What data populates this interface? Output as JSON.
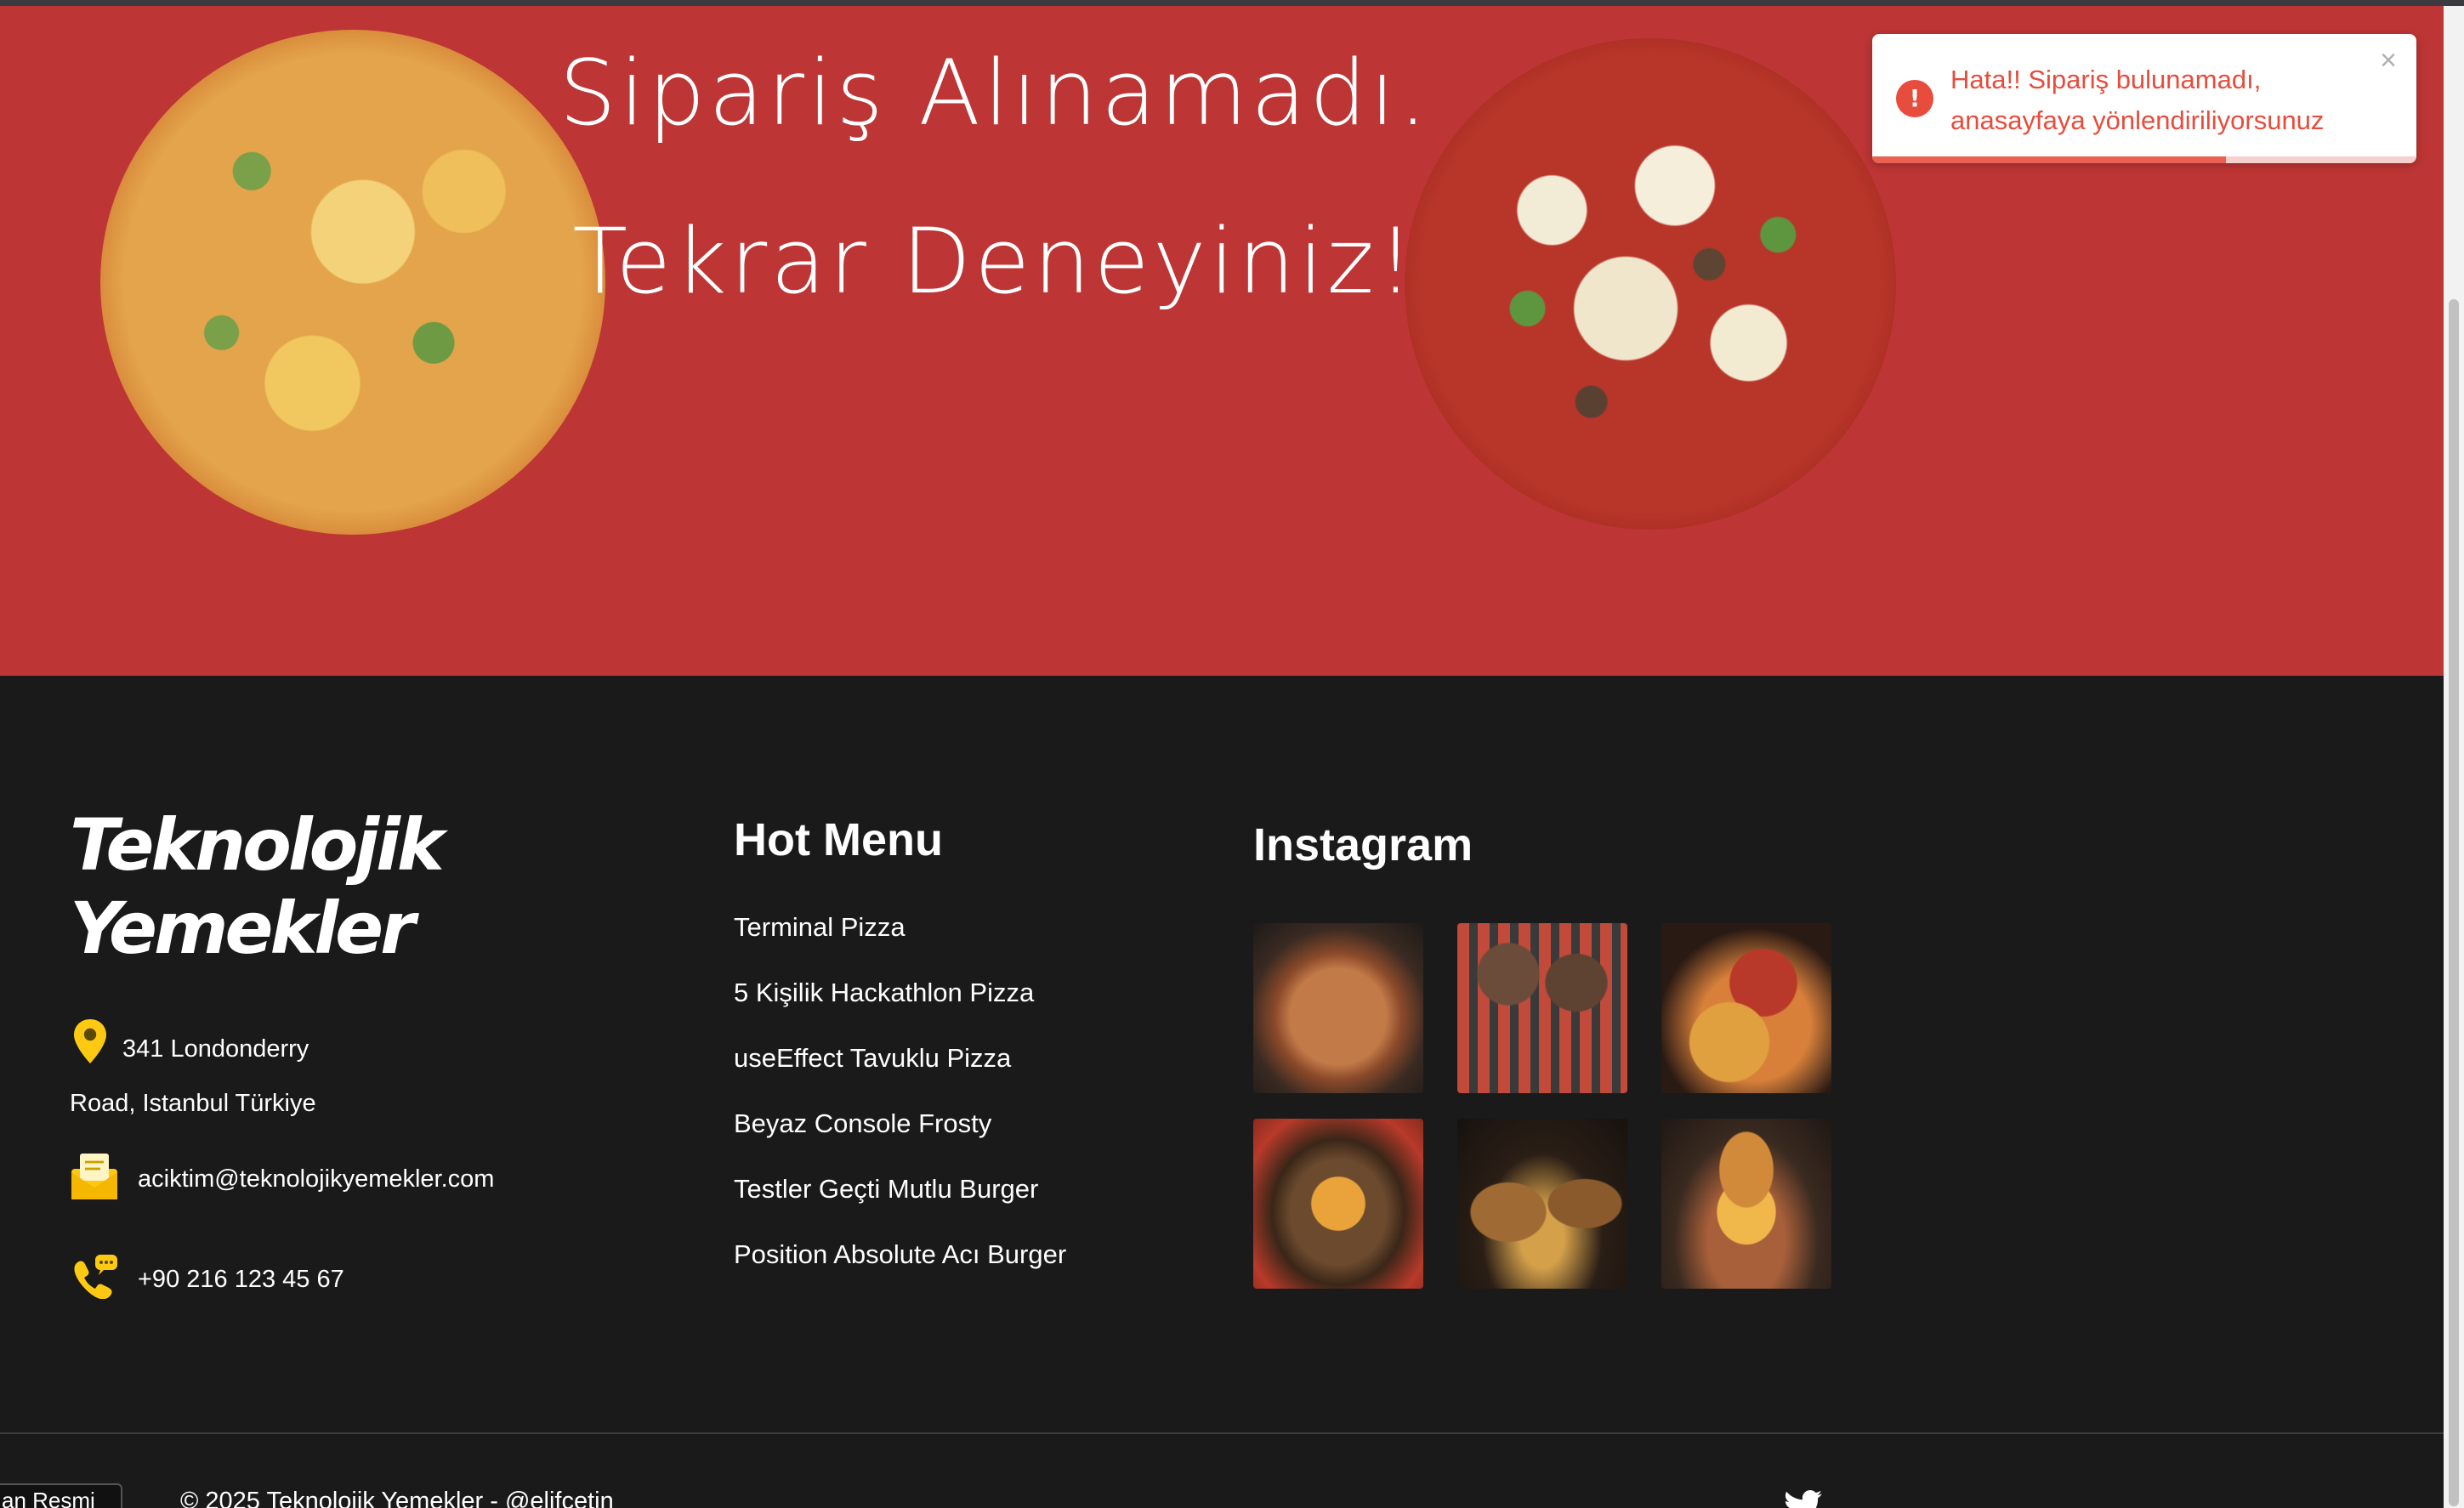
{
  "hero": {
    "line1": "Sipariş Alınamadı.",
    "line2": "Tekrar Deneyiniz!",
    "background_color": "#be3535"
  },
  "toast": {
    "message_line1": "Hata!! Sipariş bulunamadı,",
    "message_line2": "anasayfaya yönlendiriliyorsunuz",
    "icon_text": "!",
    "close_label": "×",
    "progress": 0.65,
    "color": "#e74c3c"
  },
  "footer": {
    "brand_line1": "Teknolojik",
    "brand_line2": "Yemekler",
    "address_line1": "341 Londonderry",
    "address_line2": "Road, Istanbul Türkiye",
    "email": "aciktim@teknolojikyemekler.com",
    "phone": "+90 216 123 45 67",
    "hot_menu_title": "Hot Menu",
    "menu_items": [
      "Terminal Pizza",
      "5 Kişilik Hackathlon Pizza",
      "useEffect Tavuklu Pizza",
      "Beyaz Console Frosty",
      "Testler Geçti Mutlu Burger",
      "Position Absolute Acı Burger"
    ],
    "instagram_title": "Instagram",
    "instagram_images": [
      "pizza",
      "grill",
      "pepperoni-pizza",
      "cheese-burger",
      "burger-fries",
      "double-burger"
    ],
    "badge_text": "an Resmi",
    "copyright": "© 2025 Teknolojik Yemekler - @elifcetin",
    "social_icon": "twitter-icon"
  },
  "colors": {
    "icon_yellow": "#fdc913",
    "footer_bg": "#1a1a1a"
  }
}
